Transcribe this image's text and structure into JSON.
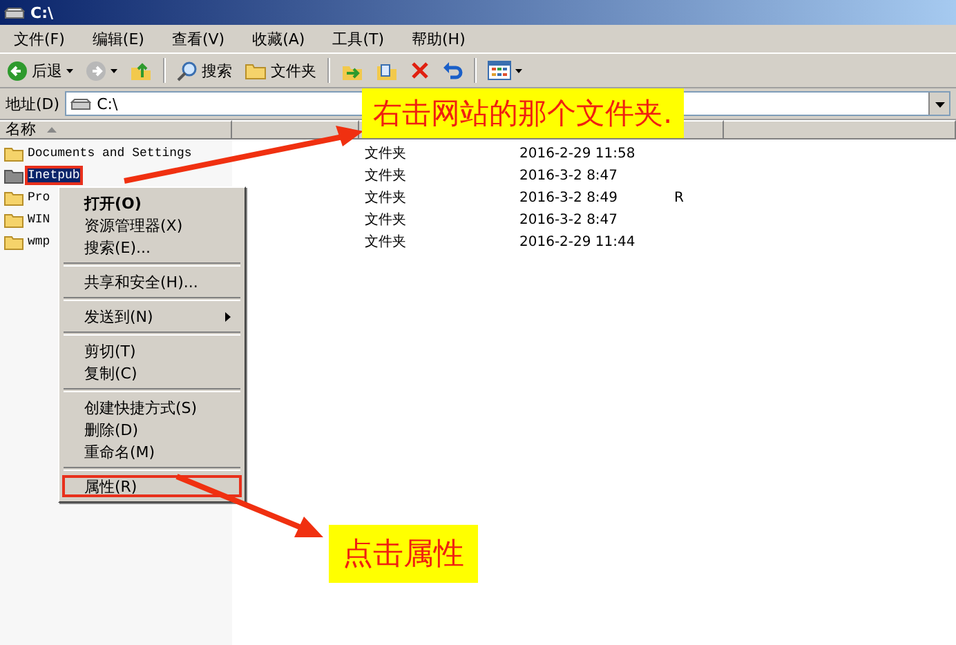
{
  "window": {
    "title": "C:\\"
  },
  "menu_bar": [
    {
      "label": "文件(F)"
    },
    {
      "label": "编辑(E)"
    },
    {
      "label": "查看(V)"
    },
    {
      "label": "收藏(A)"
    },
    {
      "label": "工具(T)"
    },
    {
      "label": "帮助(H)"
    }
  ],
  "toolbar": [
    {
      "kind": "back",
      "label": "后退"
    },
    {
      "kind": "forward"
    },
    {
      "kind": "up"
    },
    {
      "kind": "sep"
    },
    {
      "kind": "search",
      "label": "搜索"
    },
    {
      "kind": "folders",
      "label": "文件夹"
    },
    {
      "kind": "sep"
    },
    {
      "kind": "move"
    },
    {
      "kind": "copy"
    },
    {
      "kind": "delete"
    },
    {
      "kind": "undo"
    },
    {
      "kind": "sep"
    },
    {
      "kind": "views"
    }
  ],
  "address": {
    "label": "地址(D)",
    "value": "C:\\"
  },
  "columns": [
    {
      "label": "名称"
    }
  ],
  "files": [
    {
      "name": "Documents and Settings",
      "type": "文件夹",
      "modified": "2016-2-29 11:58",
      "selected": false,
      "outlined": false
    },
    {
      "name": "Inetpub",
      "type": "文件夹",
      "modified": "2016-3-2 8:47",
      "selected": true,
      "outlined": true
    },
    {
      "name": "Pro",
      "type": "文件夹",
      "modified": "2016-3-2 8:49",
      "attributes": "R",
      "selected": false,
      "outlined": false
    },
    {
      "name": "WIN",
      "type": "文件夹",
      "modified": "2016-3-2 8:47",
      "selected": false,
      "outlined": false
    },
    {
      "name": "wmp",
      "type": "文件夹",
      "modified": "2016-2-29 11:44",
      "selected": false,
      "outlined": false
    }
  ],
  "context_menu": [
    {
      "kind": "item",
      "label": "打开(O)",
      "default": true,
      "outlined": false
    },
    {
      "kind": "item",
      "label": "资源管理器(X)",
      "default": false,
      "outlined": false
    },
    {
      "kind": "item",
      "label": "搜索(E)...",
      "default": false,
      "outlined": false
    },
    {
      "kind": "separator"
    },
    {
      "kind": "item",
      "label": "共享和安全(H)...",
      "default": false,
      "outlined": false
    },
    {
      "kind": "separator"
    },
    {
      "kind": "submenu",
      "label": "发送到(N)",
      "default": false,
      "outlined": false
    },
    {
      "kind": "separator"
    },
    {
      "kind": "item",
      "label": "剪切(T)",
      "default": false,
      "outlined": false
    },
    {
      "kind": "item",
      "label": "复制(C)",
      "default": false,
      "outlined": false
    },
    {
      "kind": "separator"
    },
    {
      "kind": "item",
      "label": "创建快捷方式(S)",
      "default": false,
      "outlined": false
    },
    {
      "kind": "item",
      "label": "删除(D)",
      "default": false,
      "outlined": false
    },
    {
      "kind": "item",
      "label": "重命名(M)",
      "default": false,
      "outlined": false
    },
    {
      "kind": "separator"
    },
    {
      "kind": "item",
      "label": "属性(R)",
      "default": false,
      "outlined": true
    }
  ],
  "annotations": [
    {
      "text": "右击网站的那个文件夹."
    },
    {
      "text": "点击属性"
    }
  ]
}
